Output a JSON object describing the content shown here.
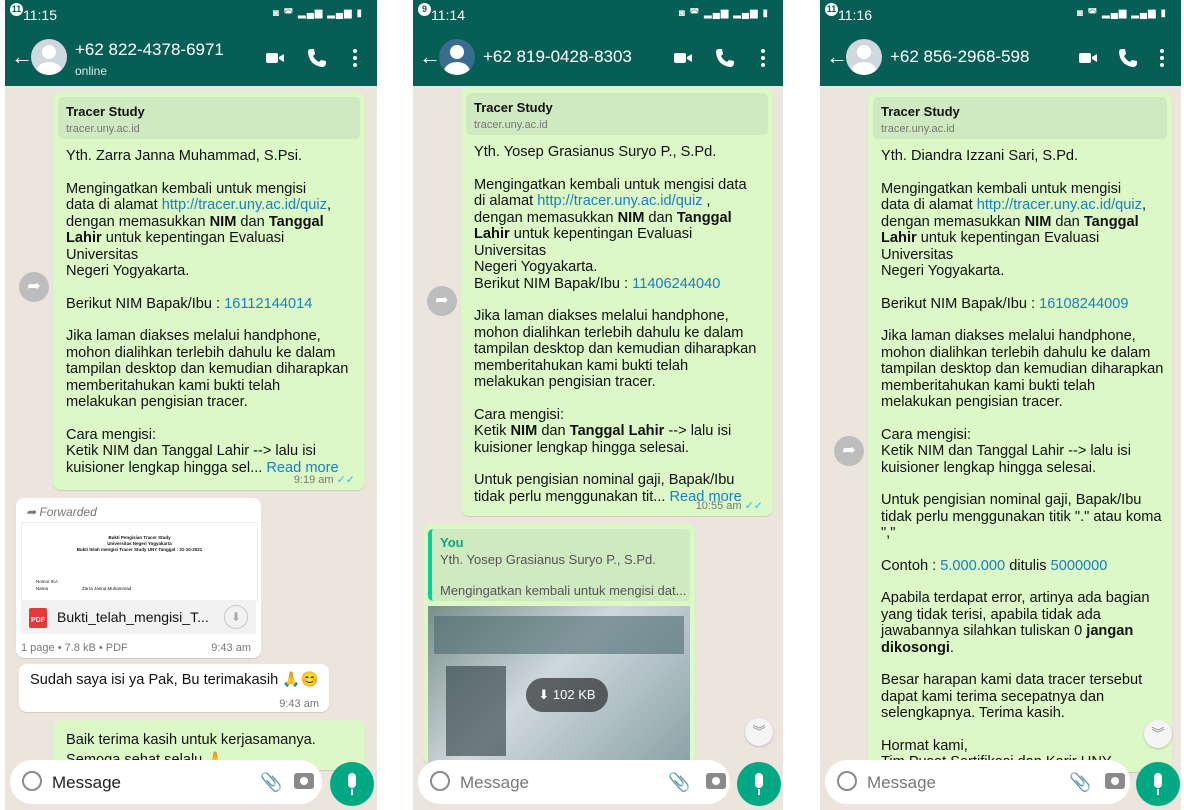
{
  "screens": [
    {
      "status_time": "11:15",
      "status_badge": "11",
      "contact_name": "+62 822-4378-6971",
      "contact_status": "online",
      "link_preview": {
        "title": "Tracer Study",
        "url": "tracer.uny.ac.id"
      },
      "msg1": {
        "greeting": "Yth. Zarra Janna Muhammad, S.Psi.",
        "p1_line1": "Mengingatkan kembali untuk mengisi",
        "p1_pre": "data di alamat ",
        "link": "http://tracer.uny.ac.id/quiz",
        "p1_post": ",",
        "p1_l3a": "dengan memasukkan ",
        "p1_b1": "NIM",
        "p1_l3b": " dan ",
        "p1_b2": "Tanggal",
        "p1_b3": "Lahir",
        "p1_l4": " untuk kepentingan Evaluasi Universitas",
        "p1_l5": "Negeri Yogyakarta.",
        "nim_label": "Berikut NIM Bapak/Ibu : ",
        "nim": "16112144014",
        "p3": "Jika laman diakses melalui handphone,\nmohon dialihkan terlebih dahulu ke dalam\ntampilan desktop dan kemudian diharapkan\nmemberitahukan kami bukti telah\nmelakukan pengisian tracer.",
        "p4": "Cara mengisi:\nKetik NIM dan Tanggal Lahir --> lalu isi",
        "p4_last": "kuisioner lengkap hingga sel... ",
        "read_more": "Read more",
        "time": "9:19 am"
      },
      "msg2": {
        "forwarded": "Forwarded",
        "doc_title": "Bukti Pengisian Tracer Study",
        "doc_sub": "Universitas Negeri Yogyakarta",
        "doc_sub2": "Bukti telah mengisi Tracer Study UNY Tanggal : 31-10-2021",
        "doc_row1_k": "Nomor IKA",
        "doc_row2_k": "Nama",
        "doc_row2_v": "Zarra Janna Muhammad",
        "file_badge": "PDF",
        "file_name": "Bukti_telah_mengisi_T...",
        "file_meta": "1 page • 7.8 kB • PDF",
        "time": "9:43 am"
      },
      "msg3": {
        "text": "Sudah saya isi ya Pak, Bu terimakasih 🙏😊",
        "time": "9:43 am"
      },
      "msg4": {
        "line1": "Baik terima kasih untuk kerjasamanya.",
        "line2": "Semoga sehat selalu 🙏"
      },
      "input_placeholder": "Message"
    },
    {
      "status_time": "11:14",
      "status_badge": "9",
      "contact_name": "+62 819-0428-8303",
      "link_preview": {
        "title": "Tracer Study",
        "url": "tracer.uny.ac.id"
      },
      "msg1": {
        "greeting": "Yth. Yosep Grasianus Suryo P., S.Pd.",
        "p1_line1": "Mengingatkan kembali untuk mengisi data",
        "p1_pre": "di alamat ",
        "link": "http://tracer.uny.ac.id/quiz",
        "p1_post": " ,",
        "p1_l3a": "dengan memasukkan ",
        "p1_b1": "NIM",
        "p1_l3b": " dan ",
        "p1_b2": "Tanggal",
        "p1_b3": "Lahir",
        "p1_l4": " untuk kepentingan Evaluasi Universitas",
        "p1_l5": "Negeri Yogyakarta.",
        "nim_label": "Berikut NIM Bapak/Ibu : ",
        "nim": "11406244040",
        "p3": "Jika laman diakses melalui handphone,\nmohon dialihkan terlebih dahulu ke dalam\ntampilan desktop dan kemudian diharapkan\nmemberitahukan kami bukti telah\nmelakukan pengisian tracer.",
        "p4_l1": "Cara mengisi:",
        "p4_l2a": "Ketik ",
        "p4_b1": "NIM",
        "p4_l2b": " dan ",
        "p4_b2": "Tanggal Lahir",
        "p4_l2c": " --> lalu isi",
        "p4_l3": "kuisioner lengkap hingga selesai.",
        "p5": "Untuk pengisian nominal gaji, Bapak/Ibu",
        "p5_last": "tidak perlu menggunakan tit... ",
        "read_more": "Read more",
        "time": "10:55 am"
      },
      "msg2": {
        "quote_author": "You",
        "quote_line1": "Yth. Yosep Grasianus Suryo P., S.Pd.",
        "quote_line2": "Mengingatkan kembali untuk mengisi dat...",
        "download_size": "102 KB"
      },
      "input_placeholder": "Message"
    },
    {
      "status_time": "11:16",
      "status_badge": "11",
      "contact_name": "+62 856-2968-598",
      "link_preview": {
        "title": "Tracer Study",
        "url": "tracer.uny.ac.id"
      },
      "msg1": {
        "greeting": "Yth. Diandra Izzani Sari, S.Pd.",
        "p1_line1": "Mengingatkan kembali untuk mengisi",
        "p1_pre": "data di alamat ",
        "link": "http://tracer.uny.ac.id/quiz",
        "p1_post": ",",
        "p1_l3a": "dengan memasukkan ",
        "p1_b1": "NIM",
        "p1_l3b": " dan ",
        "p1_b2": "Tanggal",
        "p1_b3": "Lahir",
        "p1_l4": " untuk kepentingan Evaluasi Universitas",
        "p1_l5": "Negeri Yogyakarta.",
        "nim_label": "Berikut NIM Bapak/Ibu : ",
        "nim": "16108244009",
        "p3": "Jika laman diakses melalui handphone,\nmohon dialihkan terlebih dahulu ke dalam\ntampilan desktop dan kemudian diharapkan\nmemberitahukan kami bukti telah\nmelakukan pengisian tracer.",
        "p4": "Cara mengisi:\nKetik NIM dan Tanggal Lahir --> lalu isi\nkuisioner lengkap hingga selesai.",
        "p5": "Untuk pengisian nominal gaji, Bapak/Ibu\ntidak perlu menggunakan titik \".\" atau koma\n\",\"",
        "example_pre": "Contoh : ",
        "example_a": "5.000.000",
        "example_mid": " ditulis ",
        "example_b": "5000000",
        "p7": "Apabila terdapat error, artinya ada bagian\nyang tidak terisi, apabila tidak ada\njawabannya silahkan tuliskan 0 ",
        "p7_b": "jangan\ndikosongi",
        "p7_end": ".",
        "p8": "Besar harapan kami data tracer tersebut\ndapat kami terima secepatnya dan\nselengkapnya. Terima kasih.",
        "p9": "Hormat kami,\nTim Pusat Sertifikasi dan Karir UNY"
      },
      "input_placeholder": "Message"
    }
  ]
}
